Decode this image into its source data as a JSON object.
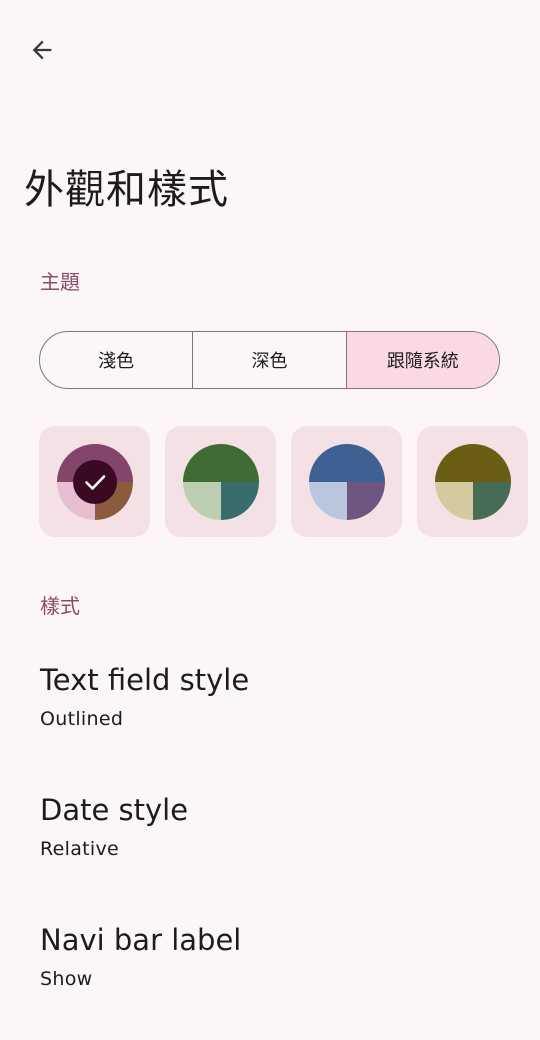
{
  "colors": {
    "background": "#fdf6f7",
    "accent_text": "#8a4a68",
    "segment_selected": "#fbd8e5",
    "swatch_background": "#f4e1e6"
  },
  "header": {
    "back_icon": "arrow-left-icon",
    "title": "外觀和樣式"
  },
  "theme_section": {
    "header": "主題",
    "modes": [
      {
        "label": "淺色",
        "selected": false
      },
      {
        "label": "深色",
        "selected": false
      },
      {
        "label": "跟隨系統",
        "selected": true
      }
    ],
    "palettes": [
      {
        "top": "#83456a",
        "bottom_left": "#e6bdd1",
        "bottom_right": "#8b5b3d",
        "selected": true,
        "check_icon": "check-icon"
      },
      {
        "top": "#3f6c35",
        "bottom_left": "#bccfb3",
        "bottom_right": "#396d6c",
        "selected": false
      },
      {
        "top": "#3f6093",
        "bottom_left": "#bac6de",
        "bottom_right": "#6e5680",
        "selected": false
      },
      {
        "top": "#6a5d14",
        "bottom_left": "#d5c9a0",
        "bottom_right": "#486b56",
        "selected": false
      }
    ]
  },
  "style_section": {
    "header": "樣式",
    "items": [
      {
        "title": "Text field style",
        "summary": "Outlined"
      },
      {
        "title": "Date style",
        "summary": "Relative"
      },
      {
        "title": "Navi bar label",
        "summary": "Show"
      }
    ]
  }
}
